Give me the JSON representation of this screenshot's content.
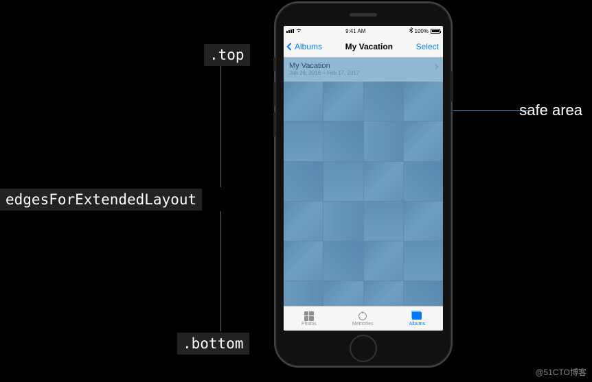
{
  "labels": {
    "top": ".top",
    "mid": "edgesForExtendedLayout",
    "bottom": ".bottom",
    "safe_area": "safe area"
  },
  "watermark": "@51CTO博客",
  "status": {
    "time": "9:41 AM",
    "battery": "100%"
  },
  "nav": {
    "back": "Albums",
    "title": "My Vacation",
    "action": "Select"
  },
  "album": {
    "title": "My Vacation",
    "date": "Jan 26, 2016 – Feb 17, 2017"
  },
  "tabs": {
    "photos": "Photos",
    "memories": "Memories",
    "albums": "Albums"
  }
}
